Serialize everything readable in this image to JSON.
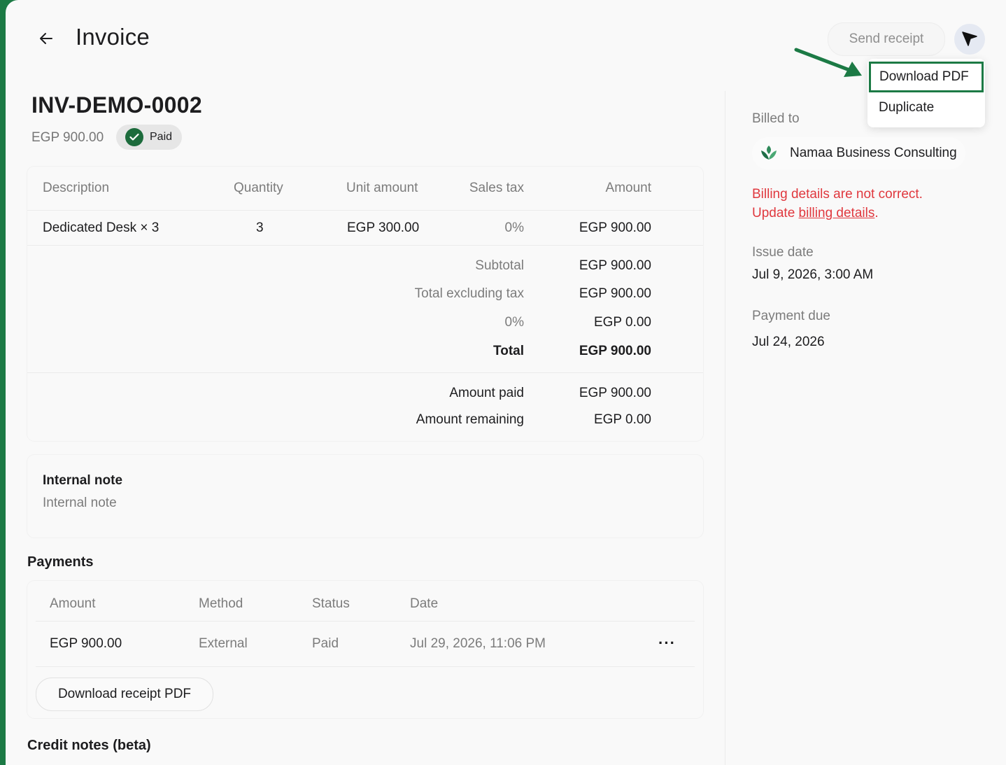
{
  "header": {
    "title": "Invoice",
    "send_receipt_label": "Send receipt"
  },
  "menu": {
    "items": [
      "Download PDF",
      "Duplicate"
    ]
  },
  "invoice": {
    "number": "INV-DEMO-0002",
    "amount": "EGP 900.00",
    "status": "Paid"
  },
  "items_table": {
    "headers": [
      "Description",
      "Quantity",
      "Unit amount",
      "Sales tax",
      "Amount"
    ],
    "rows": [
      {
        "description": "Dedicated Desk × 3",
        "quantity": "3",
        "unit_amount": "EGP 300.00",
        "sales_tax": "0%",
        "amount": "EGP 900.00"
      }
    ]
  },
  "totals": {
    "subtotal_label": "Subtotal",
    "subtotal_value": "EGP 900.00",
    "excl_tax_label": "Total excluding tax",
    "excl_tax_value": "EGP 900.00",
    "tax_label": "0%",
    "tax_value": "EGP 0.00",
    "total_label": "Total",
    "total_value": "EGP 900.00",
    "paid_label": "Amount paid",
    "paid_value": "EGP 900.00",
    "remaining_label": "Amount remaining",
    "remaining_value": "EGP 0.00"
  },
  "note": {
    "title": "Internal note",
    "placeholder": "Internal note"
  },
  "payments": {
    "title": "Payments",
    "headers": [
      "Amount",
      "Method",
      "Status",
      "Date"
    ],
    "rows": [
      {
        "amount": "EGP 900.00",
        "method": "External",
        "status": "Paid",
        "date": "Jul 29, 2026, 11:06 PM",
        "more": "···"
      }
    ],
    "download_label": "Download receipt PDF"
  },
  "credit_notes": {
    "title": "Credit notes (beta)"
  },
  "sidebar": {
    "billed_to_label": "Billed to",
    "customer_name": "Namaa Business Consulting",
    "error_line1": "Billing details are not correct.",
    "error_prefix": "Update ",
    "error_link": "billing details",
    "error_suffix": ".",
    "issue_date_label": "Issue date",
    "issue_date": "Jul 9, 2026, 3:00 AM",
    "payment_due_label": "Payment due",
    "payment_due": "Jul 24, 2026"
  },
  "colors": {
    "accent": "#1c7a45",
    "error": "#e0383e",
    "badge_check": "#1c6b3c"
  },
  "icons": {
    "back": "arrow-left-icon",
    "more": "cursor-arrow-icon",
    "paid": "check-icon",
    "customer": "leaf-logo-icon"
  }
}
